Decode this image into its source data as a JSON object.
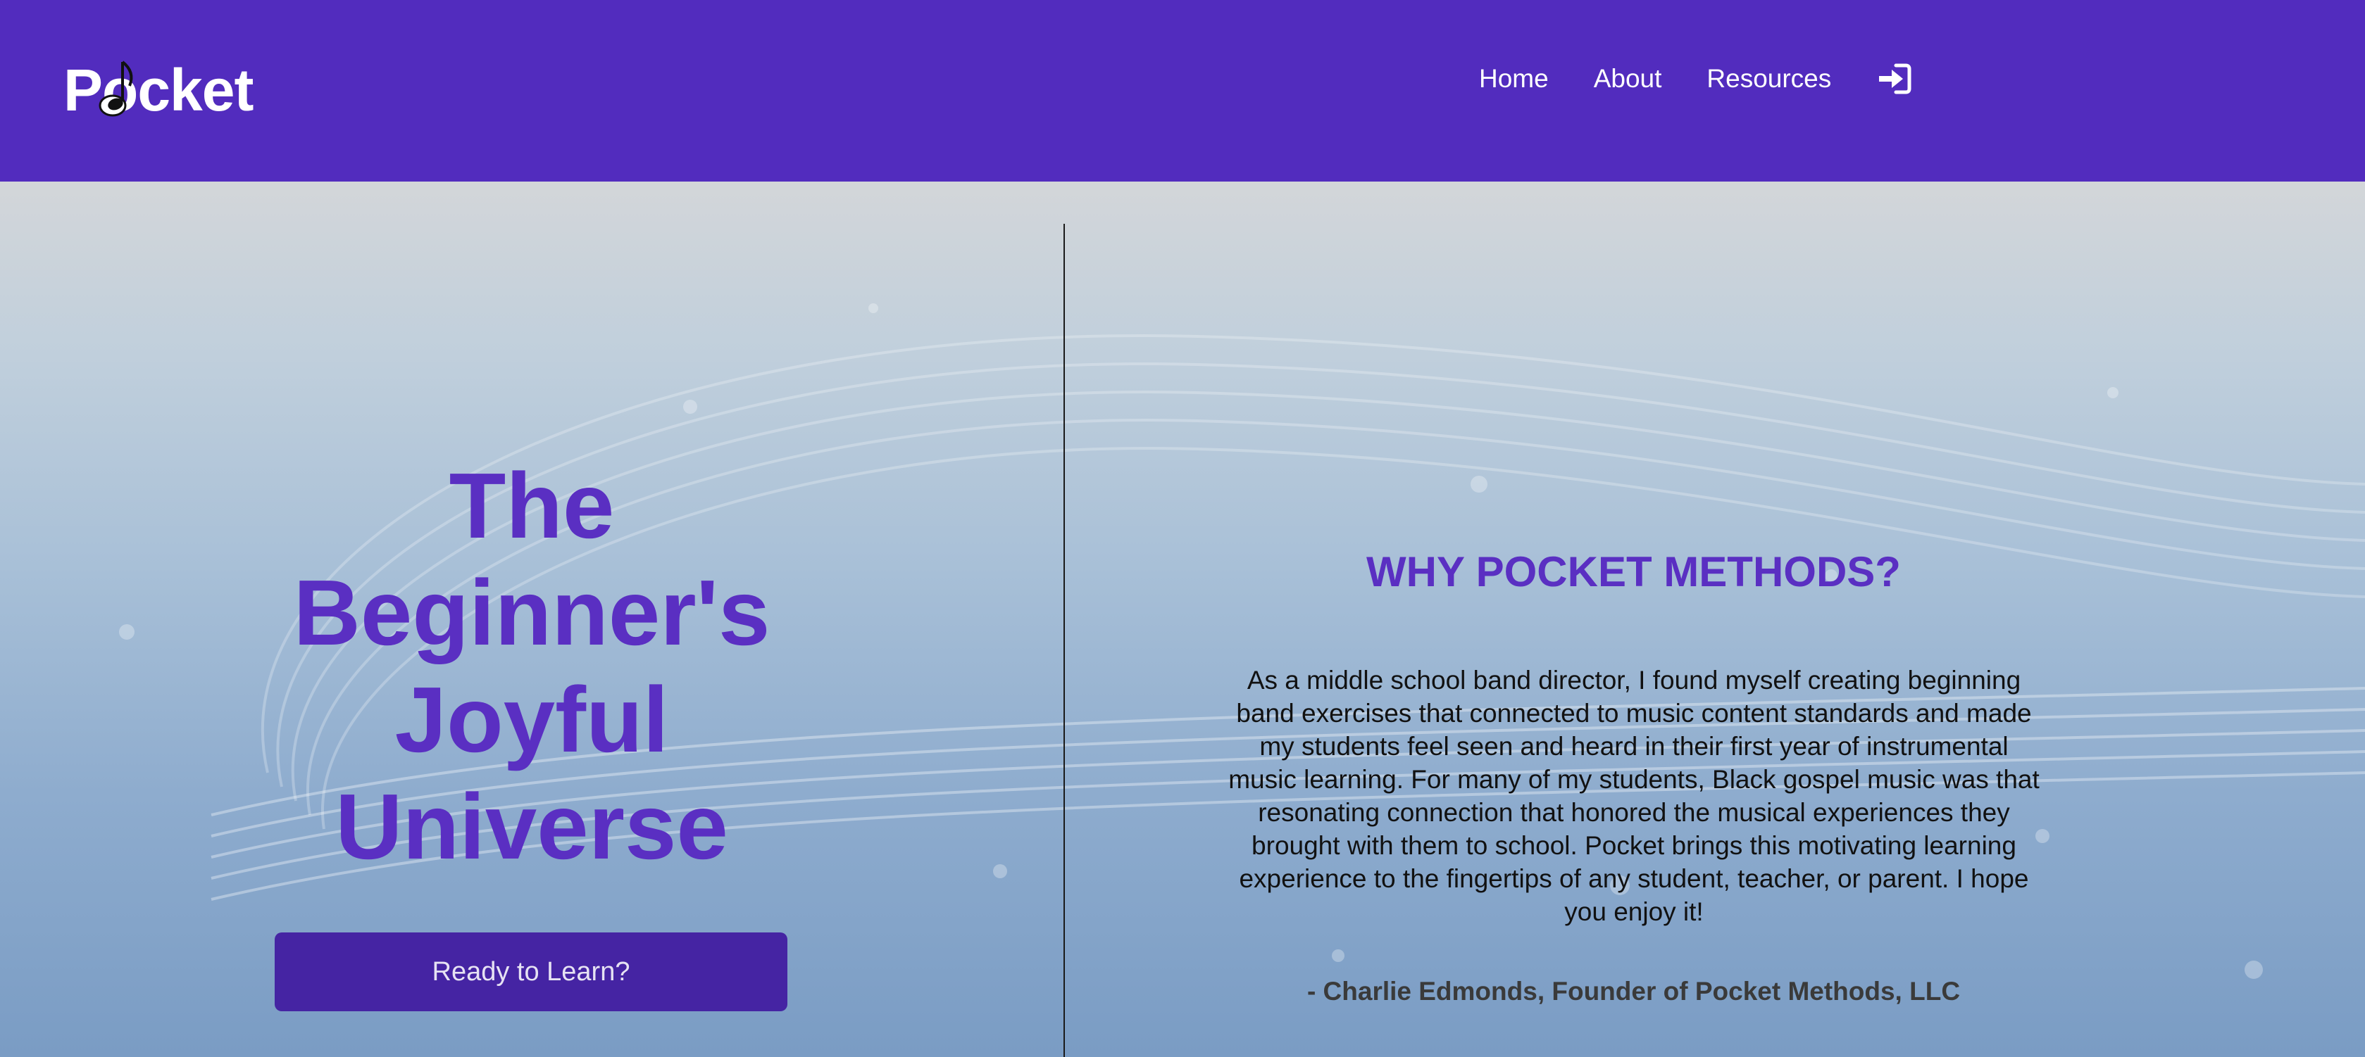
{
  "brand": {
    "logo_text": "Pocket",
    "primary_color": "#522cbe",
    "heading_color": "#5a2fc2",
    "button_color": "#4524a3"
  },
  "nav": {
    "links": [
      "Home",
      "About",
      "Resources"
    ],
    "login_icon": "sign-in-icon"
  },
  "hero": {
    "title": "The Beginner's Joyful Universe",
    "cta_label": "Ready to Learn?"
  },
  "about": {
    "heading": "WHY POCKET METHODS?",
    "body": "As a middle school band director, I found myself creating beginning band exercises that connected to music content standards and made my students feel seen and heard in their first year of instrumental music learning. For many of my students, Black gospel music was that resonating connection that honored the musical experiences they brought with them to school. Pocket brings this motivating learning experience to the fingertips of any student, teacher, or parent. I hope you enjoy it!",
    "attribution": "- Charlie Edmonds, Founder of Pocket Methods, LLC"
  }
}
